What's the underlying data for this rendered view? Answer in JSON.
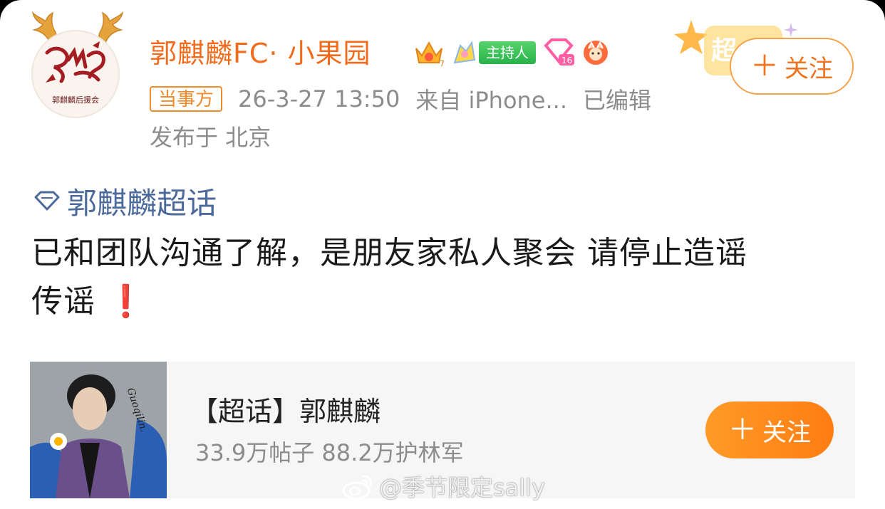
{
  "post": {
    "author": {
      "name": "郭麒麟FC· 小果园",
      "avatar_logo_text": "郭麒麟后援会",
      "badges": {
        "crown_badge_number": "7",
        "host_label": "主持人",
        "level_badge_number": "16"
      }
    },
    "party_tag": "当事方",
    "timestamp": "26-3-27 13:50",
    "source": "来自 iPhone...",
    "edited": "已编辑",
    "location": "发布于 北京",
    "topic": "郭麒麟超话",
    "content_line1": "已和团队沟通了解，是朋友家私人聚会 请停止造谣",
    "content_line2": "传谣",
    "content_emoji": "❗",
    "follow_button": {
      "plus": "＋",
      "label": "关注"
    },
    "deco_text": "超"
  },
  "supertopic_card": {
    "title": "【超话】郭麒麟",
    "stats": "33.9万帖子 88.2万护林军",
    "follow_button": {
      "plus": "＋",
      "label": "关注"
    },
    "photo_caption": "Guoqilin."
  },
  "watermark": "@季节限定sally",
  "colors": {
    "username": "#f26a1b",
    "topic_link": "#4b6a9b",
    "host_badge": "#2fb34f",
    "follow_orange": "#ff8a1d"
  }
}
